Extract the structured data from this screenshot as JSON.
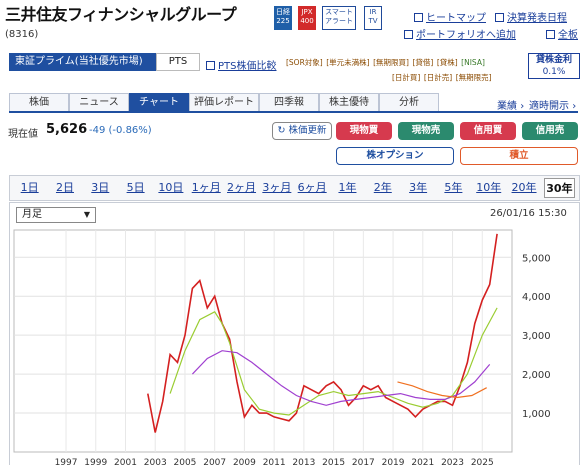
{
  "header": {
    "company": "三井住友フィナンシャルグループ",
    "code": "(8316)",
    "badges": [
      {
        "top": "日経",
        "bottom": "225",
        "style": "blue"
      },
      {
        "top": "JPX",
        "bottom": "400",
        "style": "red"
      },
      {
        "top": "スマート",
        "bottom": "アラート",
        "style": "white"
      },
      {
        "top": "IR",
        "bottom": "TV",
        "style": "white"
      }
    ],
    "links": [
      "ヒートマップ",
      "決算発表日程",
      "ポートフォリオへ追加",
      "全板"
    ]
  },
  "market": {
    "name": "東証プライム(当社優先市場)",
    "pts": "PTS",
    "pts_link": "PTS株価比較"
  },
  "tags_row1": [
    "[SOR対象]",
    "[単元未満株]",
    "[無期限買]",
    "[貸借]",
    "[貸株]",
    "[NISA]"
  ],
  "tags_row2": [
    "[日計買]",
    "[日計売]",
    "[無期限売]"
  ],
  "yield": {
    "label": "貸株金利",
    "value": "0.1%"
  },
  "tabs": [
    "株価",
    "ニュース",
    "チャート",
    "評価レポート",
    "四季報",
    "株主優待",
    "分析"
  ],
  "tabs_right": [
    "業績",
    "適時開示"
  ],
  "price": {
    "label": "現在値",
    "value": "5,626",
    "change": "-49 (-0.86%)"
  },
  "buttons": {
    "update": "株価更新",
    "buy": "現物買",
    "sell": "現物売",
    "margin_buy": "信用買",
    "margin_sell": "信用売",
    "option": "株オプション",
    "accum": "積立"
  },
  "periods": [
    "1日",
    "2日",
    "3日",
    "5日",
    "10日",
    "1ヶ月",
    "2ヶ月",
    "3ヶ月",
    "6ヶ月",
    "1年",
    "2年",
    "3年",
    "5年",
    "10年",
    "20年",
    "30年"
  ],
  "active_period": "30年",
  "chart_controls": {
    "interval": "月足",
    "timestamp": "26/01/16 15:30"
  },
  "chart_data": {
    "type": "line",
    "yticks": [
      1000,
      2000,
      3000,
      4000,
      5000
    ],
    "ytick_labels": [
      "1,000",
      "2,000",
      "3,000",
      "4,000",
      "5,000"
    ],
    "xtick_labels": [
      "1997",
      "1999",
      "2001",
      "2003",
      "2005",
      "2007",
      "2009",
      "2011",
      "2013",
      "2015",
      "2017",
      "2019",
      "2021",
      "2023",
      "2025"
    ],
    "ylim": [
      0,
      5700
    ],
    "series": [
      {
        "color": "#d42020",
        "x": [
          2002.5,
          2003.0,
          2003.5,
          2004.0,
          2004.5,
          2005.0,
          2005.5,
          2006.0,
          2006.5,
          2007.0,
          2007.5,
          2008.0,
          2008.5,
          2009.0,
          2009.5,
          2010.0,
          2010.5,
          2011.0,
          2011.5,
          2012.0,
          2012.5,
          2013.0,
          2013.5,
          2014.0,
          2014.5,
          2015.0,
          2015.5,
          2016.0,
          2016.5,
          2017.0,
          2017.5,
          2018.0,
          2018.5,
          2019.0,
          2019.5,
          2020.0,
          2020.5,
          2021.0,
          2021.5,
          2022.0,
          2022.5,
          2023.0,
          2023.5,
          2024.0,
          2024.5,
          2025.0,
          2025.5,
          2026.0
        ],
        "y": [
          1500,
          500,
          1300,
          2500,
          2300,
          3000,
          4200,
          4400,
          3700,
          4000,
          3300,
          2900,
          1800,
          900,
          1200,
          1000,
          1000,
          900,
          850,
          800,
          1000,
          1700,
          1600,
          1500,
          1700,
          1800,
          1600,
          1200,
          1400,
          1700,
          1600,
          1700,
          1400,
          1300,
          1200,
          1100,
          900,
          1100,
          1200,
          1300,
          1300,
          1200,
          1700,
          2300,
          3300,
          3900,
          4300,
          5600
        ]
      },
      {
        "color": "#9acd32",
        "x": [
          2004.0,
          2005.0,
          2006.0,
          2007.0,
          2007.5,
          2008.0,
          2009.0,
          2010.0,
          2011.0,
          2012.0,
          2013.0,
          2014.0,
          2015.0,
          2016.0,
          2017.0,
          2018.0,
          2019.0,
          2020.0,
          2021.0,
          2022.0,
          2023.0,
          2024.0,
          2025.0,
          2026.0
        ],
        "y": [
          1500,
          2600,
          3400,
          3600,
          3300,
          2800,
          1600,
          1100,
          1000,
          950,
          1200,
          1450,
          1550,
          1450,
          1500,
          1550,
          1400,
          1250,
          1150,
          1250,
          1450,
          2000,
          3000,
          3700
        ]
      },
      {
        "color": "#a040d0",
        "x": [
          2005.5,
          2006.5,
          2007.5,
          2008.5,
          2009.5,
          2010.5,
          2011.5,
          2012.5,
          2013.5,
          2014.5,
          2015.5,
          2016.5,
          2017.5,
          2018.5,
          2019.5,
          2020.5,
          2021.5,
          2022.5,
          2023.5,
          2024.5,
          2025.5
        ],
        "y": [
          2000,
          2400,
          2600,
          2550,
          2300,
          2000,
          1700,
          1450,
          1300,
          1200,
          1300,
          1350,
          1400,
          1450,
          1500,
          1400,
          1350,
          1350,
          1500,
          1800,
          2250
        ]
      },
      {
        "color": "#f07020",
        "x": [
          2019.3,
          2020.3,
          2021.3,
          2022.3,
          2023.3,
          2024.3,
          2025.3
        ],
        "y": [
          1800,
          1700,
          1550,
          1450,
          1400,
          1450,
          1650
        ]
      }
    ]
  }
}
